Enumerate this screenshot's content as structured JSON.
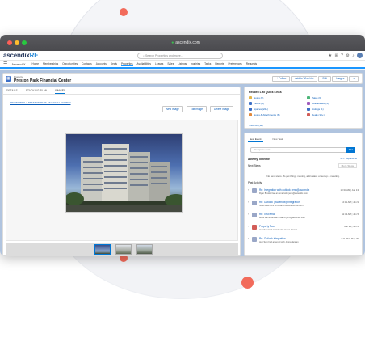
{
  "browser": {
    "url": "ascendix.com"
  },
  "app": {
    "logo_main": "ascendix",
    "logo_accent": "RE",
    "app_name": "AscendIX",
    "search_placeholder": "Search Properties and more...",
    "nav": [
      "Home",
      "Memberships",
      "Opportunities",
      "Contacts",
      "Accounts",
      "Deals",
      "Properties",
      "Availabilities",
      "Leases",
      "Sales",
      "Listings",
      "Inquiries",
      "Tasks",
      "Reports",
      "Preferences",
      "Requests"
    ]
  },
  "record": {
    "type": "Property",
    "title": "Preston Park Financial Center",
    "actions": [
      "+ Follow",
      "Add to Wish List",
      "Edit",
      "Images"
    ]
  },
  "tabs": [
    "DETAILS",
    "STACKING PLAN",
    "IMAGES"
  ],
  "images": {
    "breadcrumb": "PROPERTIES > PRESTON PARK FINANCIAL CENTER",
    "buttons": [
      "New Image",
      "Edit Image",
      "Delete Image"
    ]
  },
  "quick_links": {
    "title": "Related List Quick Links",
    "items": [
      {
        "label": "Notes (0)",
        "color": "#e6b74a"
      },
      {
        "label": "Sales (0)",
        "color": "#4fb67a"
      },
      {
        "label": "Floors (4)",
        "color": "#3c6fc7"
      },
      {
        "label": "Availabilities (3)",
        "color": "#9f5bbd"
      },
      {
        "label": "Spaces (22+)",
        "color": "#3c6fc7"
      },
      {
        "label": "Listings (1)",
        "color": "#3c6fc7"
      },
      {
        "label": "Notes & Attachments (6)",
        "color": "#e28a3c"
      },
      {
        "label": "Deals (10+)",
        "color": "#d25d58"
      }
    ],
    "view_all": "Show All (12)"
  },
  "activity": {
    "tabs": [
      "New Event",
      "New Task"
    ],
    "email_placeholder": "Compose new...",
    "compose": "Add",
    "timeline_title": "Activity Timeline",
    "tools": "Expand All",
    "next_steps": "Next Steps",
    "more_steps": "More Steps",
    "empty": "No next steps. To get things moving, add a task or set up a meeting.",
    "past": "Past Activity",
    "items": [
      {
        "title": "Re: Integration with outlook: jenn@ascendix",
        "sub": "Ryan Brooks had an email with jenn@ascendix.com",
        "date": "10:33 AM | Jun 13",
        "color": "#9aa7c7"
      },
      {
        "title": "Re: Outlook | Ascendix@Integration",
        "sub": "Scott Baxe sent an email to www.ascendix.com",
        "date": "10:31 AM | Jun 9",
        "color": "#9aa7c7"
      },
      {
        "title": "Re: Test email",
        "sub": "Miles Harris sent an email to jenn@ascendix.com",
        "date": "11:33 AM | Jun 5",
        "color": "#9aa7c7"
      },
      {
        "title": "Property Tour",
        "sub": "Jeni Sam had an task with Jenna Jansen",
        "date": "Mar 24 | Jun 2",
        "color": "#d25d58"
      },
      {
        "title": "Re: Outlook integration",
        "sub": "Jeni Sam had an email with Jenna Jansen",
        "date": "3:11 PM | May 29",
        "color": "#9aa7c7"
      }
    ]
  }
}
